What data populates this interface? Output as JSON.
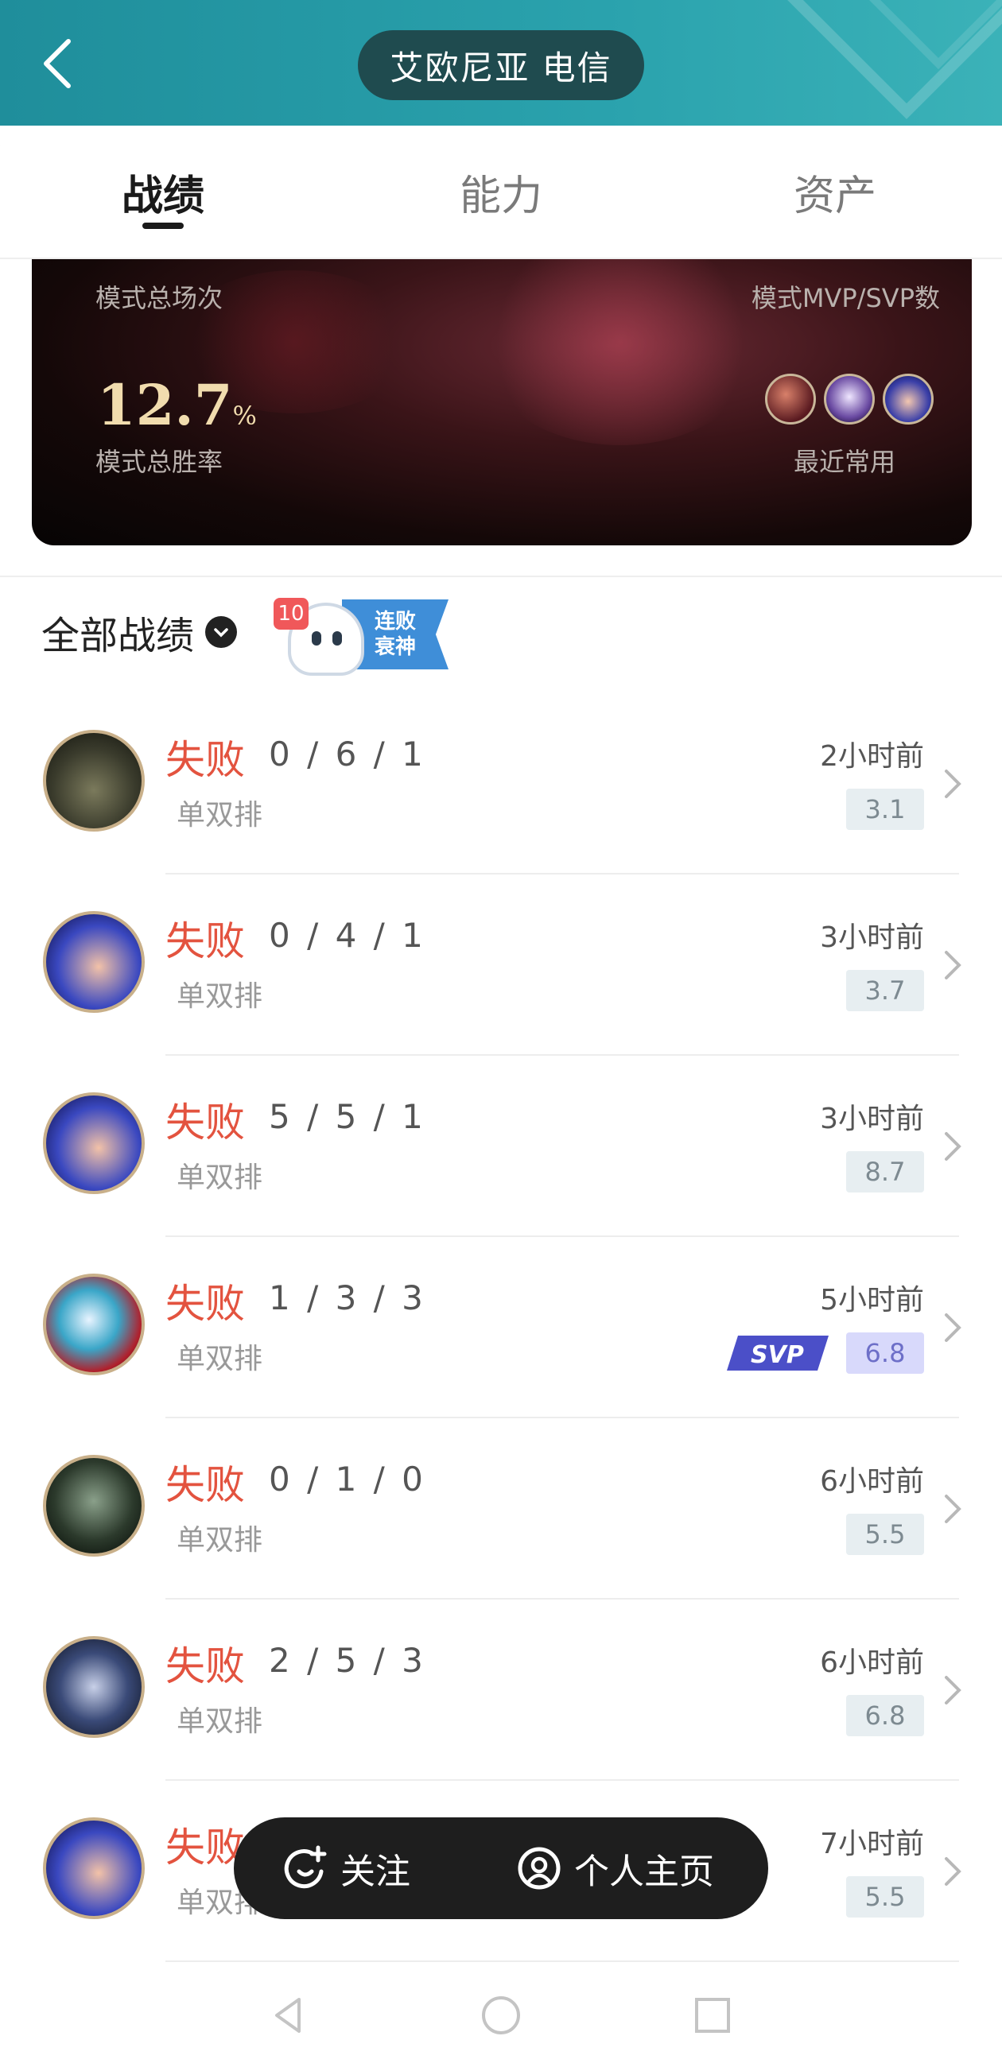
{
  "header": {
    "server": "艾欧尼亚 电信"
  },
  "tabs": [
    {
      "label": "战绩",
      "active": true
    },
    {
      "label": "能力",
      "active": false
    },
    {
      "label": "资产",
      "active": false
    }
  ],
  "stats": {
    "total_games_label": "模式总场次",
    "mvp_label": "模式MVP/SVP数",
    "win_rate_value": "12.7",
    "win_rate_unit": "%",
    "win_rate_label": "模式总胜率",
    "recent_label": "最近常用"
  },
  "filter": {
    "label": "全部战绩",
    "badge_count": "10",
    "badge_text_1": "连败",
    "badge_text_2": "衰神"
  },
  "matches": [
    {
      "result": "失败",
      "kda": "0 / 6 / 1",
      "mode": "单双排",
      "time": "2小时前",
      "score": "3.1",
      "svp": false
    },
    {
      "result": "失败",
      "kda": "0 / 4 / 1",
      "mode": "单双排",
      "time": "3小时前",
      "score": "3.7",
      "svp": false
    },
    {
      "result": "失败",
      "kda": "5 / 5 / 1",
      "mode": "单双排",
      "time": "3小时前",
      "score": "8.7",
      "svp": false
    },
    {
      "result": "失败",
      "kda": "1 / 3 / 3",
      "mode": "单双排",
      "time": "5小时前",
      "score": "6.8",
      "svp": true
    },
    {
      "result": "失败",
      "kda": "0 / 1 / 0",
      "mode": "单双排",
      "time": "6小时前",
      "score": "5.5",
      "svp": false
    },
    {
      "result": "失败",
      "kda": "2 / 5 / 3",
      "mode": "单双排",
      "time": "6小时前",
      "score": "6.8",
      "svp": false
    },
    {
      "result": "失败",
      "kda": "",
      "mode": "单双排",
      "time": "7小时前",
      "score": "5.5",
      "svp": false
    }
  ],
  "actions": {
    "follow": "关注",
    "profile": "个人主页"
  },
  "colors": {
    "header": "#2aa2ad",
    "loss": "#e3533f",
    "svp": "#6d6fc8"
  },
  "icons": [
    "back-icon",
    "chevron-down-icon",
    "follow-icon",
    "profile-icon",
    "chevron-right-icon",
    "nav-back-icon",
    "nav-home-icon",
    "nav-recent-icon"
  ]
}
